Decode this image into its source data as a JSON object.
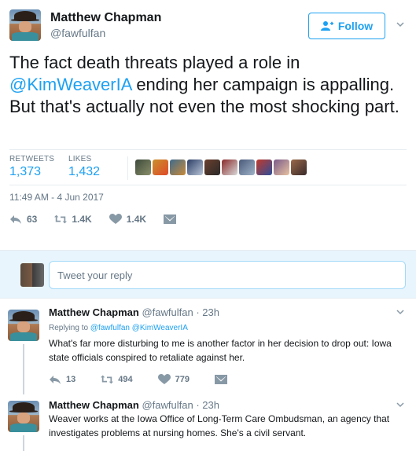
{
  "tweet": {
    "author_name": "Matthew Chapman",
    "author_handle": "@fawfulfan",
    "follow_label": "Follow",
    "text_before": "The fact death threats played a role in ",
    "mention": "@KimWeaverIA",
    "text_after": " ending her campaign is appalling. But that's actually not even the most shocking part.",
    "retweets_label": "RETWEETS",
    "retweets_value": "1,373",
    "likes_label": "LIKES",
    "likes_value": "1,432",
    "timestamp": "11:49 AM - 4 Jun 2017",
    "reply_count": "63",
    "retweet_count": "1.4K",
    "like_count": "1.4K"
  },
  "compose": {
    "placeholder": "Tweet your reply"
  },
  "replies": [
    {
      "author_name": "Matthew Chapman",
      "author_handle": "@fawfulfan",
      "time": "· 23h",
      "replying_prefix": "Replying to",
      "replying_to": "@fawfulfan @KimWeaverIA",
      "text": "What's far more disturbing to me is another factor in her decision to drop out: Iowa state officials conspired to retaliate against her.",
      "reply_count": "13",
      "retweet_count": "494",
      "like_count": "779"
    },
    {
      "author_name": "Matthew Chapman",
      "author_handle": "@fawfulfan",
      "time": "· 23h",
      "text": "Weaver works at the Iowa Office of Long-Term Care Ombudsman, an agency that investigates problems at nursing homes. She's a civil servant."
    }
  ],
  "colors": {
    "accent": "#1da1f2",
    "muted": "#657786",
    "reply_bar_bg": "#e8f5fd"
  },
  "icons": {
    "reply": "reply-icon",
    "retweet": "retweet-icon",
    "like": "heart-icon",
    "dm": "envelope-icon",
    "follow": "add-person-icon",
    "caret": "chevron-down-icon"
  }
}
